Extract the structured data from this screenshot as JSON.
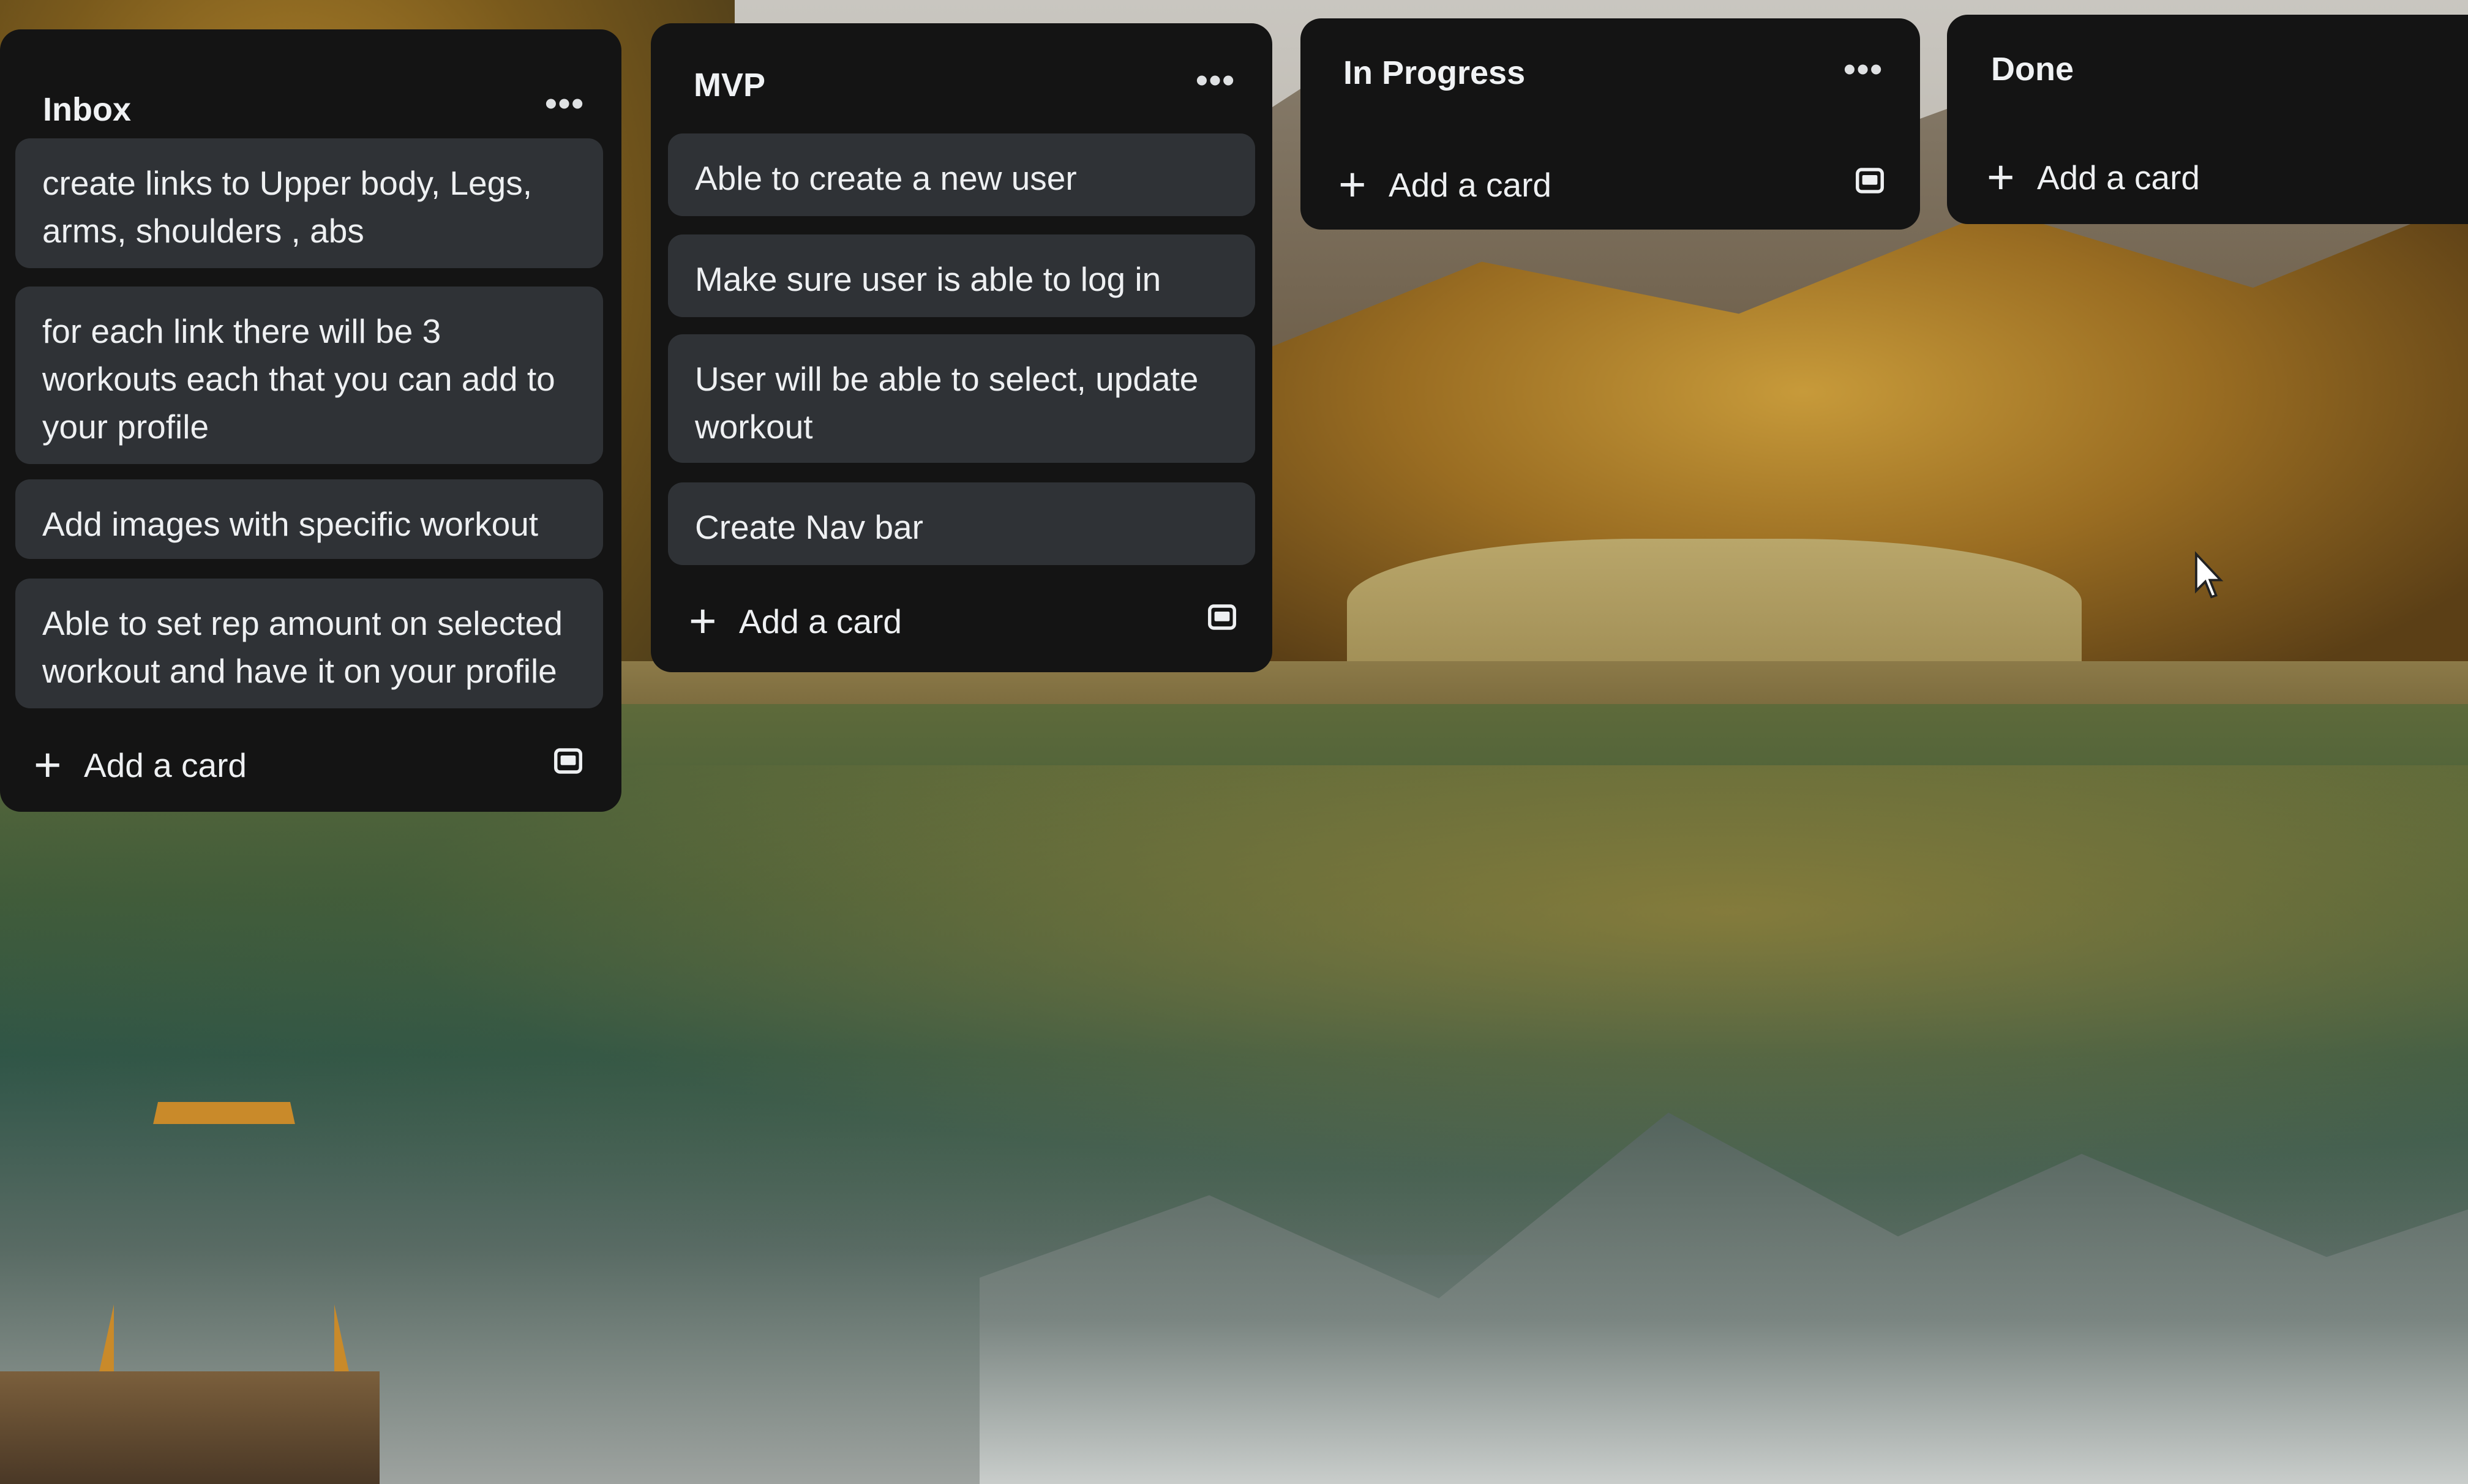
{
  "board": {
    "lists": [
      {
        "title": "Inbox",
        "menu_icon": "more-horizontal-icon",
        "cards": [
          {
            "text": "create links to Upper body, Legs, arms, shoulders , abs"
          },
          {
            "text": "for each link there will be 3 workouts each that you can add to your profile"
          },
          {
            "text": "Add images with specific workout"
          },
          {
            "text": "Able to set rep amount on selected workout and have it on your profile"
          }
        ],
        "add_label": "Add a card",
        "template_icon": "card-template-icon"
      },
      {
        "title": "MVP",
        "menu_icon": "more-horizontal-icon",
        "cards": [
          {
            "text": "Able to create a new user"
          },
          {
            "text": "Make sure user is able to log in"
          },
          {
            "text": "User will be able to select, update workout"
          },
          {
            "text": "Create Nav bar"
          }
        ],
        "add_label": "Add a card",
        "template_icon": "card-template-icon"
      },
      {
        "title": "In Progress",
        "menu_icon": "more-horizontal-icon",
        "cards": [],
        "add_label": "Add a card",
        "template_icon": "card-template-icon"
      },
      {
        "title": "Done",
        "cards": [],
        "add_label": "Add a card"
      }
    ],
    "menu_glyph": "•••",
    "plus_glyph": "+"
  },
  "colors": {
    "list_bg": "#141414",
    "card_bg": "#2f3236",
    "text": "#eef0f2"
  }
}
